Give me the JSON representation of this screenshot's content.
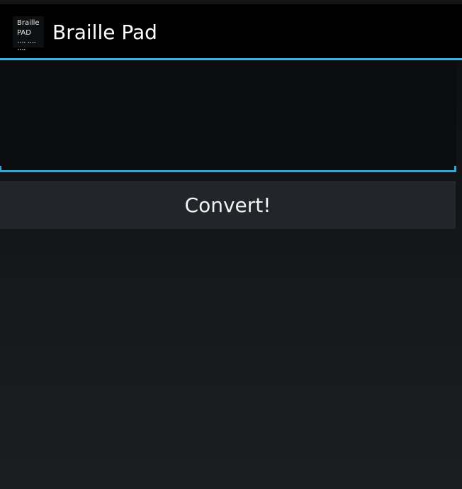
{
  "app": {
    "title": "Braille Pad",
    "icon": {
      "name": "braille-pad-app-icon",
      "line1": "Braille",
      "line2": "PAD",
      "dots": "⠤⠤ ⠤⠤ ⠤⠤"
    }
  },
  "input": {
    "value": "",
    "placeholder": ""
  },
  "convert_button": {
    "label": "Convert!"
  },
  "colors": {
    "accent": "#33b5e5",
    "action_bar": "#000000",
    "button": "#22262a"
  }
}
